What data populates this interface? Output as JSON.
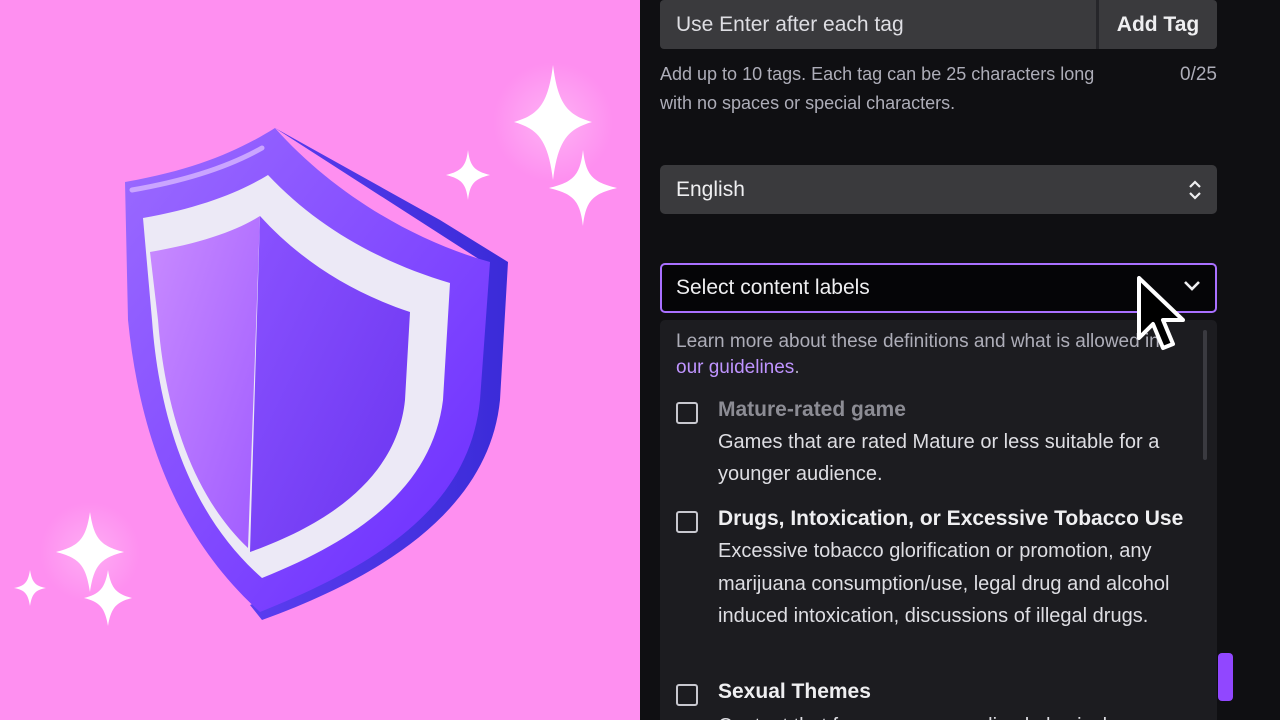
{
  "tags": {
    "input_placeholder": "Use Enter after each tag",
    "add_button": "Add Tag",
    "help_text": "Add up to 10 tags. Each tag can be 25 characters long with no spaces or special characters.",
    "counter": "0/25"
  },
  "language": {
    "selected": "English"
  },
  "content_labels": {
    "placeholder": "Select content labels",
    "learn_prefix": "Learn more about these definitions and what is allowed in ",
    "learn_link": "our guidelines",
    "learn_suffix": ".",
    "options": [
      {
        "title": "Mature-rated game",
        "desc": "Games that are rated Mature or less suitable for a younger audience."
      },
      {
        "title": "Drugs, Intoxication, or Excessive Tobacco Use",
        "desc": "Excessive tobacco glorification or promotion, any marijuana consumption/use, legal drug and alcohol induced intoxication, discussions of illegal drugs."
      },
      {
        "title": "Sexual Themes",
        "desc": "Content that focuses on sexualized physical"
      }
    ]
  },
  "colors": {
    "accent": "#a970ff",
    "link": "#bf94ff",
    "left_background": "#fe8ff0"
  }
}
